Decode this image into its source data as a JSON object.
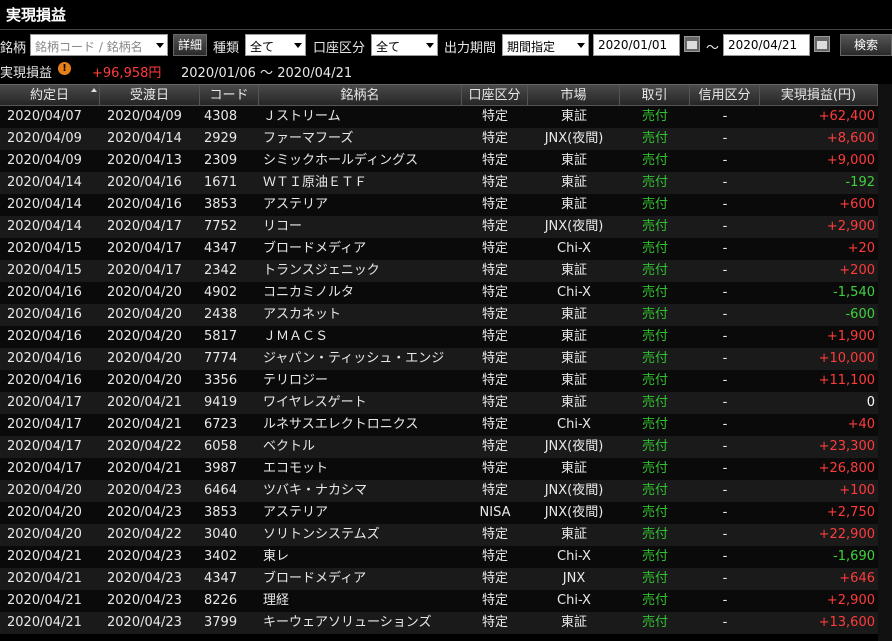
{
  "title": "実現損益",
  "filters": {
    "stock_label": "銘柄",
    "stock_placeholder": "銘柄コード / 銘柄名",
    "detail_button": "詳細",
    "type_label": "種類",
    "type_value": "全て",
    "account_label": "口座区分",
    "account_value": "全て",
    "period_label": "出力期間",
    "period_value": "期間指定",
    "date_from": "2020/01/01",
    "tilde": "～",
    "date_to": "2020/04/21",
    "search_button": "検索"
  },
  "summary": {
    "label": "実現損益",
    "warn_glyph": "!",
    "amount": "+96,958円",
    "range": "2020/01/06 ～ 2020/04/21"
  },
  "columns": [
    "約定日",
    "受渡日",
    "コード",
    "銘柄名",
    "口座区分",
    "市場",
    "取引",
    "信用区分",
    "実現損益(円)"
  ],
  "rows": [
    {
      "date": "2020/04/07",
      "deliv": "2020/04/09",
      "code": "4308",
      "name": "Ｊストリーム",
      "acct": "特定",
      "mkt": "東証",
      "trade": "売付",
      "credit": "-",
      "pl": "+62,400",
      "sign": "pos"
    },
    {
      "date": "2020/04/09",
      "deliv": "2020/04/14",
      "code": "2929",
      "name": "ファーマフーズ",
      "acct": "特定",
      "mkt": "JNX(夜間)",
      "trade": "売付",
      "credit": "-",
      "pl": "+8,600",
      "sign": "pos"
    },
    {
      "date": "2020/04/09",
      "deliv": "2020/04/13",
      "code": "2309",
      "name": "シミックホールディングス",
      "acct": "特定",
      "mkt": "東証",
      "trade": "売付",
      "credit": "-",
      "pl": "+9,000",
      "sign": "pos"
    },
    {
      "date": "2020/04/14",
      "deliv": "2020/04/16",
      "code": "1671",
      "name": "ＷＴＩ原油ＥＴＦ",
      "acct": "特定",
      "mkt": "東証",
      "trade": "売付",
      "credit": "-",
      "pl": "-192",
      "sign": "neg"
    },
    {
      "date": "2020/04/14",
      "deliv": "2020/04/16",
      "code": "3853",
      "name": "アステリア",
      "acct": "特定",
      "mkt": "東証",
      "trade": "売付",
      "credit": "-",
      "pl": "+600",
      "sign": "pos"
    },
    {
      "date": "2020/04/14",
      "deliv": "2020/04/17",
      "code": "7752",
      "name": "リコー",
      "acct": "特定",
      "mkt": "JNX(夜間)",
      "trade": "売付",
      "credit": "-",
      "pl": "+2,900",
      "sign": "pos"
    },
    {
      "date": "2020/04/15",
      "deliv": "2020/04/17",
      "code": "4347",
      "name": "ブロードメディア",
      "acct": "特定",
      "mkt": "Chi-X",
      "trade": "売付",
      "credit": "-",
      "pl": "+20",
      "sign": "pos"
    },
    {
      "date": "2020/04/15",
      "deliv": "2020/04/17",
      "code": "2342",
      "name": "トランスジェニック",
      "acct": "特定",
      "mkt": "東証",
      "trade": "売付",
      "credit": "-",
      "pl": "+200",
      "sign": "pos"
    },
    {
      "date": "2020/04/16",
      "deliv": "2020/04/20",
      "code": "4902",
      "name": "コニカミノルタ",
      "acct": "特定",
      "mkt": "Chi-X",
      "trade": "売付",
      "credit": "-",
      "pl": "-1,540",
      "sign": "neg"
    },
    {
      "date": "2020/04/16",
      "deliv": "2020/04/20",
      "code": "2438",
      "name": "アスカネット",
      "acct": "特定",
      "mkt": "東証",
      "trade": "売付",
      "credit": "-",
      "pl": "-600",
      "sign": "neg"
    },
    {
      "date": "2020/04/16",
      "deliv": "2020/04/20",
      "code": "5817",
      "name": "ＪＭＡＣＳ",
      "acct": "特定",
      "mkt": "東証",
      "trade": "売付",
      "credit": "-",
      "pl": "+1,900",
      "sign": "pos"
    },
    {
      "date": "2020/04/16",
      "deliv": "2020/04/20",
      "code": "7774",
      "name": "ジャパン・ティッシュ・エンジ",
      "acct": "特定",
      "mkt": "東証",
      "trade": "売付",
      "credit": "-",
      "pl": "+10,000",
      "sign": "pos"
    },
    {
      "date": "2020/04/16",
      "deliv": "2020/04/20",
      "code": "3356",
      "name": "テリロジー",
      "acct": "特定",
      "mkt": "東証",
      "trade": "売付",
      "credit": "-",
      "pl": "+11,100",
      "sign": "pos"
    },
    {
      "date": "2020/04/17",
      "deliv": "2020/04/21",
      "code": "9419",
      "name": "ワイヤレスゲート",
      "acct": "特定",
      "mkt": "東証",
      "trade": "売付",
      "credit": "-",
      "pl": "0",
      "sign": "zero"
    },
    {
      "date": "2020/04/17",
      "deliv": "2020/04/21",
      "code": "6723",
      "name": "ルネサスエレクトロニクス",
      "acct": "特定",
      "mkt": "Chi-X",
      "trade": "売付",
      "credit": "-",
      "pl": "+40",
      "sign": "pos"
    },
    {
      "date": "2020/04/17",
      "deliv": "2020/04/22",
      "code": "6058",
      "name": "ベクトル",
      "acct": "特定",
      "mkt": "JNX(夜間)",
      "trade": "売付",
      "credit": "-",
      "pl": "+23,300",
      "sign": "pos"
    },
    {
      "date": "2020/04/17",
      "deliv": "2020/04/21",
      "code": "3987",
      "name": "エコモット",
      "acct": "特定",
      "mkt": "東証",
      "trade": "売付",
      "credit": "-",
      "pl": "+26,800",
      "sign": "pos"
    },
    {
      "date": "2020/04/20",
      "deliv": "2020/04/23",
      "code": "6464",
      "name": "ツバキ・ナカシマ",
      "acct": "特定",
      "mkt": "JNX(夜間)",
      "trade": "売付",
      "credit": "-",
      "pl": "+100",
      "sign": "pos"
    },
    {
      "date": "2020/04/20",
      "deliv": "2020/04/23",
      "code": "3853",
      "name": "アステリア",
      "acct": "NISA",
      "mkt": "JNX(夜間)",
      "trade": "売付",
      "credit": "-",
      "pl": "+2,750",
      "sign": "pos"
    },
    {
      "date": "2020/04/20",
      "deliv": "2020/04/22",
      "code": "3040",
      "name": "ソリトンシステムズ",
      "acct": "特定",
      "mkt": "東証",
      "trade": "売付",
      "credit": "-",
      "pl": "+22,900",
      "sign": "pos"
    },
    {
      "date": "2020/04/21",
      "deliv": "2020/04/23",
      "code": "3402",
      "name": "東レ",
      "acct": "特定",
      "mkt": "Chi-X",
      "trade": "売付",
      "credit": "-",
      "pl": "-1,690",
      "sign": "neg"
    },
    {
      "date": "2020/04/21",
      "deliv": "2020/04/23",
      "code": "4347",
      "name": "ブロードメディア",
      "acct": "特定",
      "mkt": "JNX",
      "trade": "売付",
      "credit": "-",
      "pl": "+646",
      "sign": "pos"
    },
    {
      "date": "2020/04/21",
      "deliv": "2020/04/23",
      "code": "8226",
      "name": "理経",
      "acct": "特定",
      "mkt": "Chi-X",
      "trade": "売付",
      "credit": "-",
      "pl": "+2,900",
      "sign": "pos"
    },
    {
      "date": "2020/04/21",
      "deliv": "2020/04/23",
      "code": "3799",
      "name": "キーウェアソリューションズ",
      "acct": "特定",
      "mkt": "東証",
      "trade": "売付",
      "credit": "-",
      "pl": "+13,600",
      "sign": "pos"
    }
  ],
  "colors": {
    "positive": "#ff3c3c",
    "negative": "#3fd13f",
    "trade": "#31c131",
    "warn": "#e8801a"
  }
}
